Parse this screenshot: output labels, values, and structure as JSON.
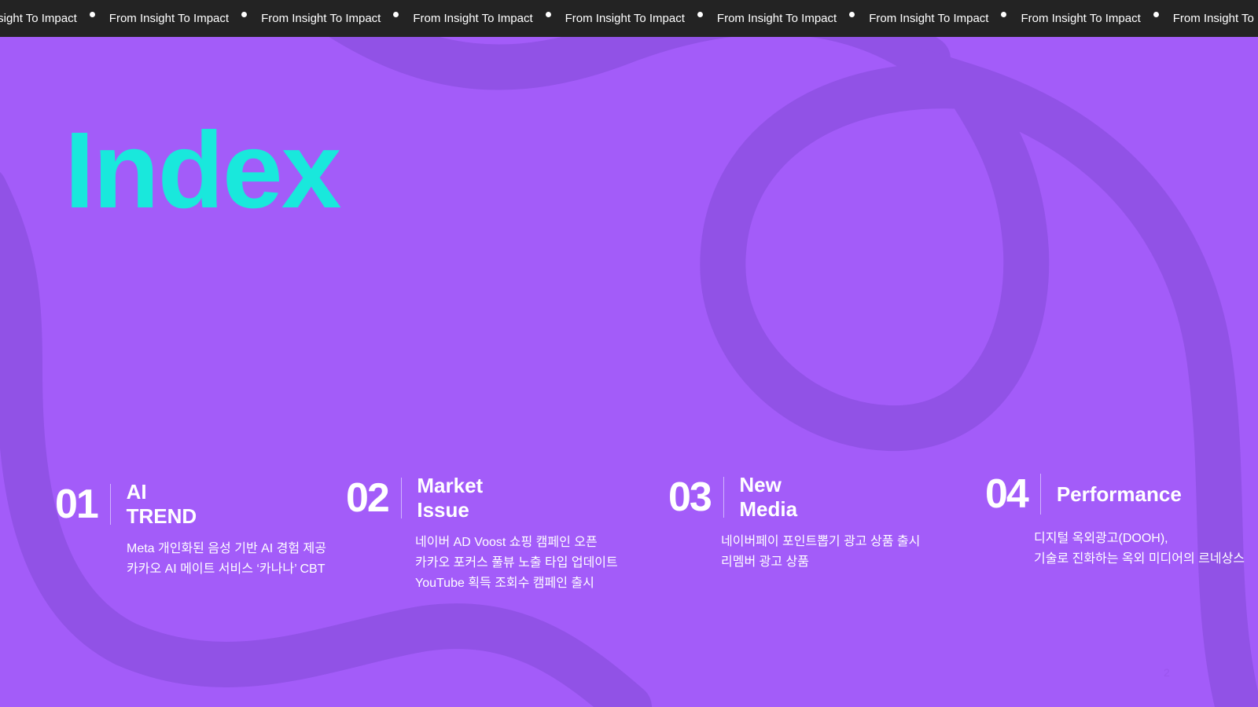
{
  "ticker": {
    "first": "m Insight To Impact",
    "repeat": "From Insight To Impact",
    "last": "From Insight To"
  },
  "title": "Index",
  "sections": [
    {
      "number": "01",
      "title": "AI TREND",
      "items": [
        "Meta 개인화된 음성 기반 AI 경험 제공",
        "카카오 AI 메이트 서비스 ‘카나나’ CBT"
      ]
    },
    {
      "number": "02",
      "title": "Market Issue",
      "items": [
        "네이버 AD Voost 쇼핑 캠페인 오픈",
        "카카오 포커스 풀뷰 노출 타입 업데이트",
        "YouTube 획득 조회수 캠페인 출시"
      ]
    },
    {
      "number": "03",
      "title": "New Media",
      "items": [
        "네이버페이 포인트뽑기 광고 상품 출시",
        "리멤버 광고 상품"
      ]
    },
    {
      "number": "04",
      "title": "Performance",
      "items": [
        "디지털 옥외광고(DOOH),",
        "기술로 진화하는 옥외 미디어의 르네상스"
      ]
    }
  ],
  "page_number": "2",
  "colors": {
    "background": "#a35cf9",
    "title": "#19e8dc",
    "ticker_bg": "#232323",
    "curve": "#9152e6"
  }
}
